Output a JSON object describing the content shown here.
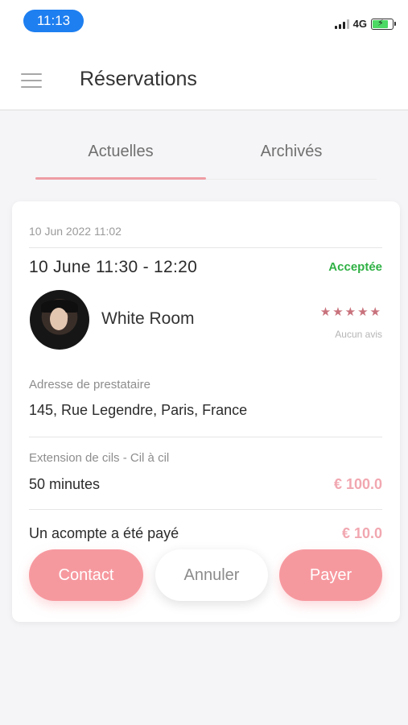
{
  "status_bar": {
    "time": "11:13",
    "network": "4G",
    "battery_level": 0.8,
    "colors": {
      "time_pill": "#1e7ff0",
      "battery": "#4cd964"
    }
  },
  "header": {
    "title": "Réservations",
    "menu_icon": "hamburger-menu-icon"
  },
  "tabs": [
    {
      "label": "Actuelles",
      "active": true
    },
    {
      "label": "Archivés",
      "active": false
    }
  ],
  "reservation": {
    "created_at": "10 Jun 2022 11:02",
    "slot": "10 June 11:30 - 12:20",
    "status": "Acceptée",
    "provider": {
      "name": "White Room",
      "avatar": "avatar-photo",
      "stars": "★★★★★",
      "reviews_text": "Aucun avis"
    },
    "address": {
      "label": "Adresse de prestataire",
      "value": "145, Rue Legendre, Paris, France"
    },
    "service": {
      "label": "Extension de cils - Cil à cil",
      "duration": "50 minutes",
      "price": "€ 100.0"
    },
    "deposit": {
      "text": "Un acompte a été payé",
      "amount": "€ 10.0"
    }
  },
  "actions": {
    "contact_label": "Contact",
    "cancel_label": "Annuler",
    "pay_label": "Payer"
  },
  "colors": {
    "accent": "#f6999f",
    "accepted": "#2fb144",
    "price": "#f1a7b0",
    "stars": "#c8727c"
  }
}
